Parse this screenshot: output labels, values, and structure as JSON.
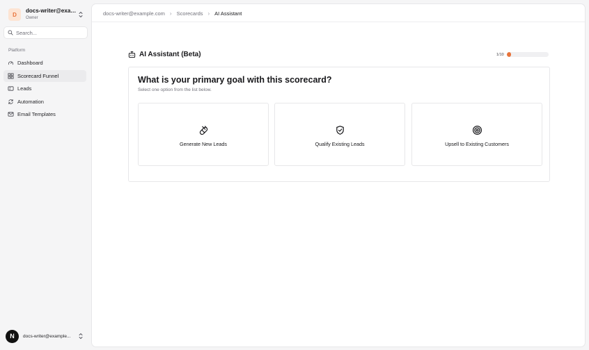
{
  "workspace": {
    "avatar_letter": "D",
    "name": "docs-writer@exam...",
    "role": "Owner"
  },
  "search": {
    "placeholder": "Search..."
  },
  "sidebar": {
    "section_label": "Platform",
    "items": [
      {
        "label": "Dashboard",
        "icon": "dashboard-icon",
        "active": false
      },
      {
        "label": "Scorecard Funnel",
        "icon": "funnel-icon",
        "active": true
      },
      {
        "label": "Leads",
        "icon": "leads-icon",
        "active": false
      },
      {
        "label": "Automation",
        "icon": "automation-icon",
        "active": false
      },
      {
        "label": "Email Templates",
        "icon": "mail-icon",
        "active": false
      }
    ]
  },
  "user": {
    "avatar_letter": "N",
    "email": "docs-writer@example..."
  },
  "breadcrumb": {
    "items": [
      "docs-writer@example.com",
      "Scorecards",
      "AI Assistant"
    ]
  },
  "assistant": {
    "title": "AI Assistant (Beta)",
    "progress_text": "1/10",
    "progress_value": 0.1,
    "accent_color": "#e8733a"
  },
  "question": {
    "title": "What is your primary goal with this scorecard?",
    "subtitle": "Select one option from the list below.",
    "options": [
      {
        "label": "Generate New Leads",
        "icon": "magnet-icon"
      },
      {
        "label": "Qualify Existing Leads",
        "icon": "shield-check-icon"
      },
      {
        "label": "Upsell to Existing Customers",
        "icon": "target-icon"
      }
    ]
  }
}
